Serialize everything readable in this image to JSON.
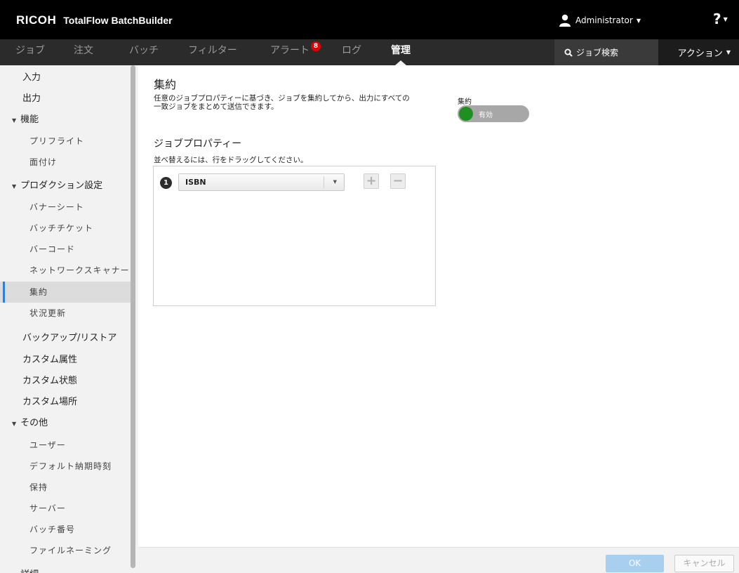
{
  "header": {
    "brand": "RICOH",
    "product": "TotalFlow BatchBuilder",
    "user": "Administrator",
    "help": "?"
  },
  "nav": {
    "tabs": [
      "ジョブ",
      "注文",
      "バッチ",
      "フィルター",
      "アラート",
      "ログ",
      "管理"
    ],
    "active_tab": "管理",
    "alert_count": "8",
    "search_label": "ジョブ検索",
    "actions_label": "アクション"
  },
  "sidebar": {
    "items": [
      "入力",
      "出力",
      "機能",
      "プリフライト",
      "面付け",
      "プロダクション設定",
      "バナーシート",
      "バッチチケット",
      "バーコード",
      "ネットワークスキャナー",
      "集約",
      "状況更新",
      "バックアップ/リストア",
      "カスタム属性",
      "カスタム状態",
      "カスタム場所",
      "その他",
      "ユーザー",
      "デフォルト納期時刻",
      "保持",
      "サーバー",
      "バッチ番号",
      "ファイルネーミング",
      "詳細"
    ],
    "selected": "集約"
  },
  "main": {
    "title": "集約",
    "description_line1": "任意のジョブプロパティーに基づき、ジョブを集約してから、出力にすべての",
    "description_line2": "一致ジョブをまとめて送信できます。",
    "toggle_label": "集約",
    "toggle_state": "有効",
    "section_title": "ジョブプロパティー",
    "hint": "並べ替えるには、行をドラッグしてください。",
    "property_row": {
      "number": "1",
      "value": "ISBN"
    }
  },
  "footer": {
    "ok": "OK",
    "cancel": "キャンセル"
  },
  "colors": {
    "toggle_on": "#1f8f22",
    "selection_bar": "#2f7ed8",
    "alert_badge": "#e20000",
    "ok_button": "#a9cfee"
  },
  "icons": [
    "user-icon",
    "search-icon",
    "plus-icon",
    "minus-icon",
    "chevron-down-icon",
    "triangle-down-icon"
  ]
}
